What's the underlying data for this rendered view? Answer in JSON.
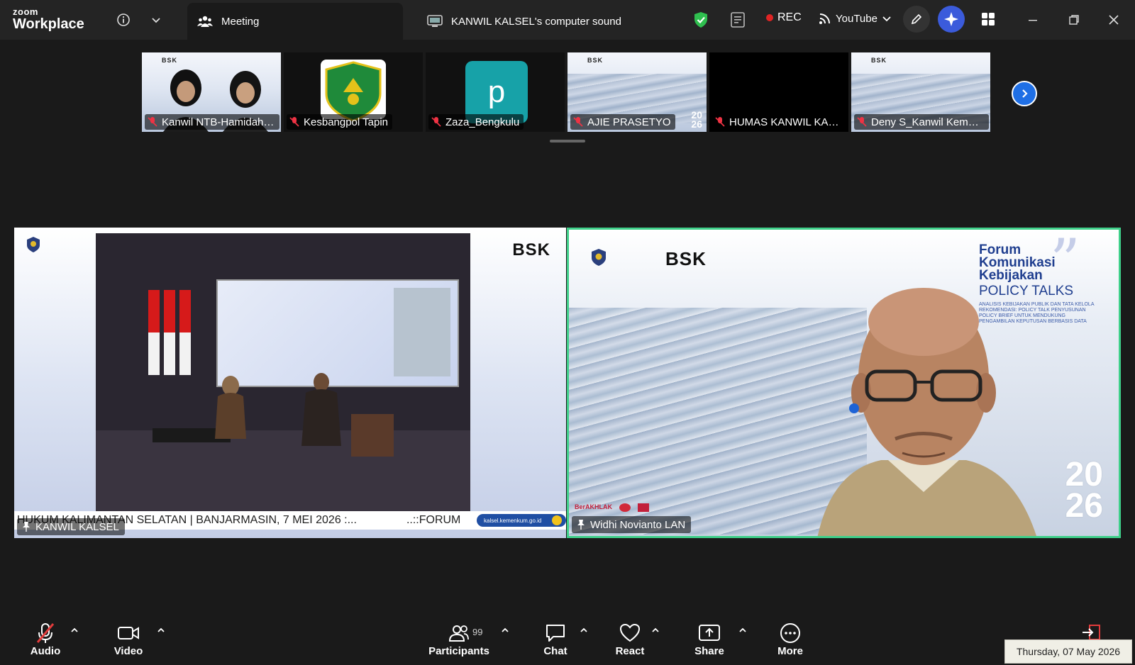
{
  "app": {
    "brand_top": "zoom",
    "brand_bottom": "Workplace"
  },
  "tabs": {
    "meeting": "Meeting",
    "sound": "KANWIL KALSEL's computer sound"
  },
  "header": {
    "rec_label": "REC",
    "stream_label": "YouTube"
  },
  "thumbnails": [
    {
      "name": "Kanwil NTB-Hamidah ..."
    },
    {
      "name": "Kesbangpol Tapin"
    },
    {
      "name": "Zaza_Bengkulu",
      "avatar_letter": "p"
    },
    {
      "name": "AJIE PRASETYO"
    },
    {
      "name": "HUMAS KANWIL KALS..."
    },
    {
      "name": "Deny S_Kanwil Kemen..."
    }
  ],
  "main_videos": {
    "left": {
      "label": "KANWIL KALSEL",
      "ticker_a": "HUKUM KALIMANTAN SELATAN | BANJARMASIN, 7 MEI 2026 :...",
      "ticker_b": "..::FORUM",
      "ticker_pill": "kalsel.kemenkum.go.id",
      "bsk": "BSK"
    },
    "right": {
      "label": "Widhi Novianto LAN",
      "bsk": "BSK",
      "forum_lines": [
        "Forum",
        "Komunikasi",
        "Kebijakan"
      ],
      "policy": "POLICY TALKS",
      "year_top": "20",
      "year_bottom": "26",
      "desc": "ANALISIS KEBIJAKAN PUBLIK DAN TATA KELOLA REKOMENDASI: POLICY TALK PENYUSUNAN POLICY BRIEF UNTUK MENDUKUNG PENGAMBILAN KEPUTUSAN BERBASIS DATA",
      "badge_1": "BerAKHLAK"
    }
  },
  "toolbar": {
    "audio": "Audio",
    "video": "Video",
    "participants": "Participants",
    "participants_count": "99",
    "chat": "Chat",
    "react": "React",
    "share": "Share",
    "more": "More"
  },
  "taskbar": {
    "date": "Thursday, 07 May 2026"
  },
  "colors": {
    "speaker_border": "#3fd08a",
    "rec_dot": "#e02424",
    "accent_blue": "#1f6fe5",
    "ai_button": "#3b5bdb",
    "shield_green": "#2fbf4f"
  }
}
